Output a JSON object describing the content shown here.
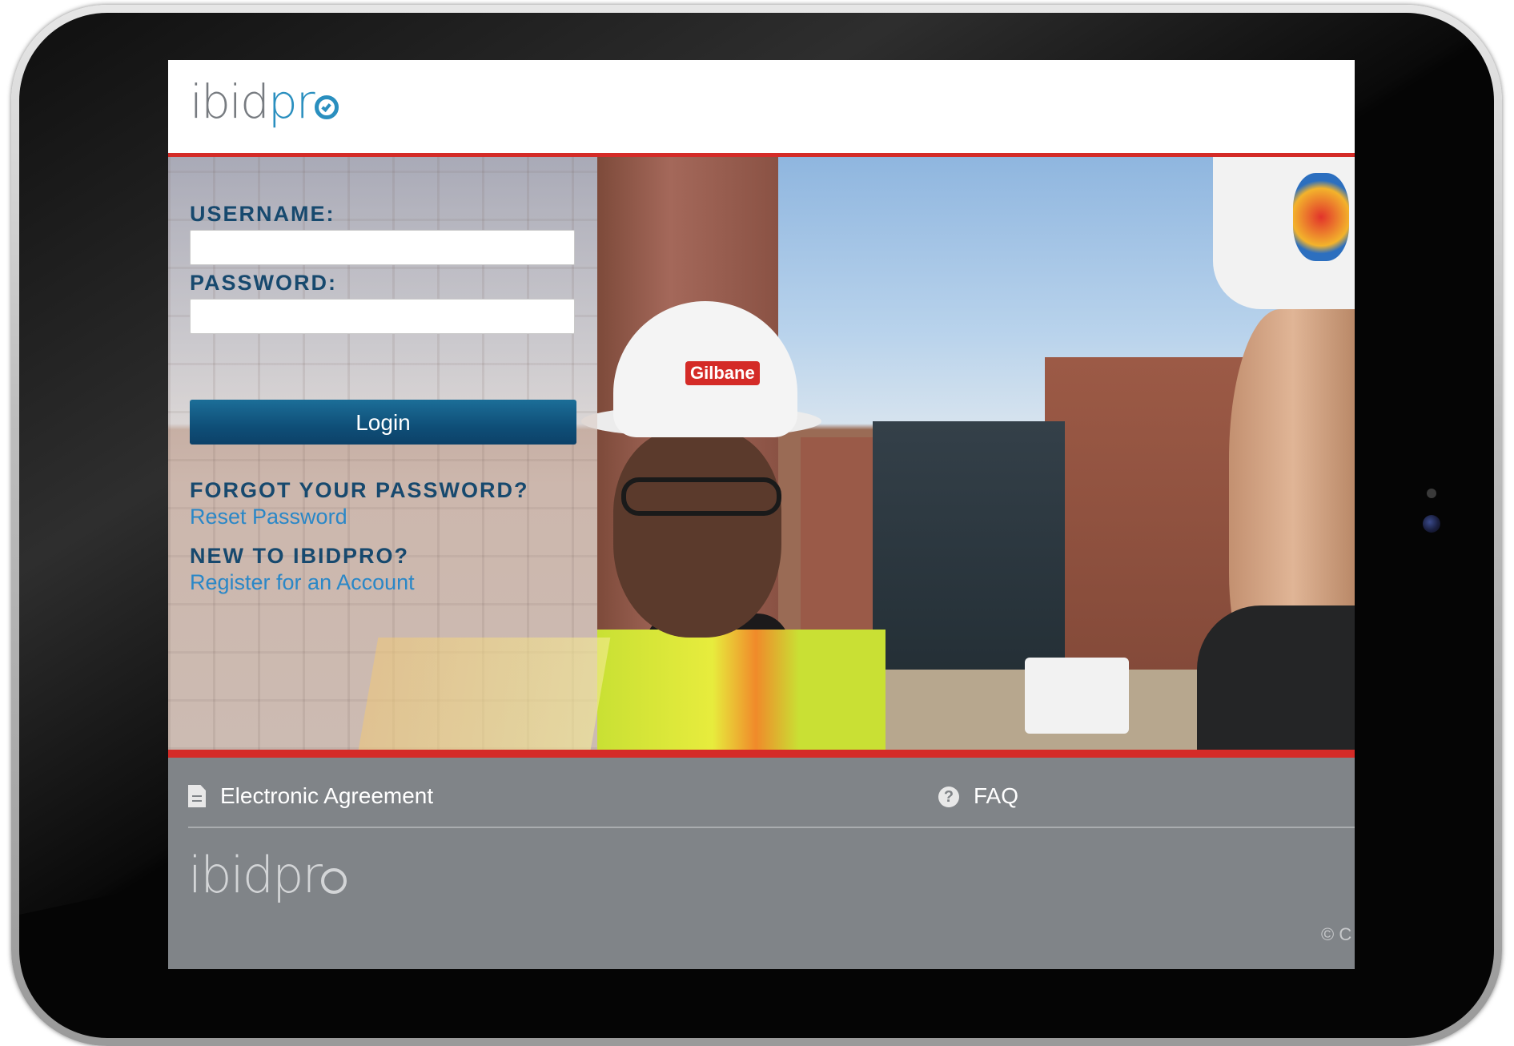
{
  "brand": {
    "logo_ibid": "ibid",
    "logo_pr": "pr",
    "footer_logo_ibid": "ibid",
    "footer_logo_pr": "pr",
    "accent_color": "#d42b27",
    "primary_color": "#17496e",
    "link_color": "#2a87c7"
  },
  "login": {
    "username_label": "USERNAME:",
    "username_value": "",
    "password_label": "PASSWORD:",
    "password_value": "",
    "login_button": "Login"
  },
  "help": {
    "forgot_title": "FORGOT YOUR PASSWORD?",
    "reset_link": "Reset Password",
    "new_title": "NEW TO IBIDPRO?",
    "register_link": "Register for an Account"
  },
  "hero": {
    "hardhat_text": "Gilbane"
  },
  "footer": {
    "agreement_icon": "document-icon",
    "agreement_link": "Electronic Agreement",
    "faq_icon": "question-circle-icon",
    "faq_link": "FAQ",
    "copyright": "© C"
  }
}
